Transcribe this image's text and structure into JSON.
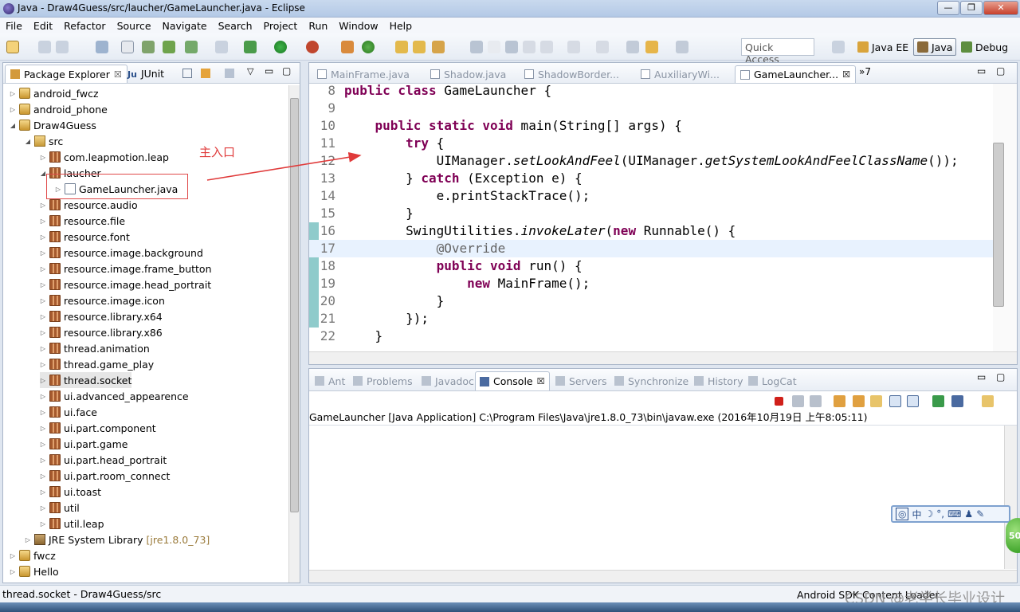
{
  "window": {
    "title": "Java - Draw4Guess/src/laucher/GameLauncher.java - Eclipse",
    "buttons": [
      "—",
      "❐",
      "✕"
    ]
  },
  "menu": [
    "File",
    "Edit",
    "Refactor",
    "Source",
    "Navigate",
    "Search",
    "Project",
    "Run",
    "Window",
    "Help"
  ],
  "toolbar": {
    "quick_access": "Quick Access",
    "perspectives": [
      "Java EE",
      "Java",
      "Debug"
    ],
    "active_perspective": "Java"
  },
  "explorer": {
    "tabs": [
      "Package Explorer",
      "JUnit"
    ],
    "tree": [
      {
        "label": "android_fwcz",
        "type": "proj",
        "depth": 0,
        "tw": "▷"
      },
      {
        "label": "android_phone",
        "type": "proj",
        "depth": 0,
        "tw": "▷"
      },
      {
        "label": "Draw4Guess",
        "type": "proj",
        "depth": 0,
        "tw": "◢"
      },
      {
        "label": "src",
        "type": "src",
        "depth": 1,
        "tw": "◢"
      },
      {
        "label": "com.leapmotion.leap",
        "type": "pkg",
        "depth": 2,
        "tw": "▷"
      },
      {
        "label": "laucher",
        "type": "pkg",
        "depth": 2,
        "tw": "◢"
      },
      {
        "label": "GameLauncher.java",
        "type": "java",
        "depth": 3,
        "tw": "▷"
      },
      {
        "label": "resource.audio",
        "type": "pkg",
        "depth": 2,
        "tw": "▷"
      },
      {
        "label": "resource.file",
        "type": "pkg",
        "depth": 2,
        "tw": "▷"
      },
      {
        "label": "resource.font",
        "type": "pkg",
        "depth": 2,
        "tw": "▷"
      },
      {
        "label": "resource.image.background",
        "type": "pkg",
        "depth": 2,
        "tw": "▷"
      },
      {
        "label": "resource.image.frame_button",
        "type": "pkg",
        "depth": 2,
        "tw": "▷"
      },
      {
        "label": "resource.image.head_portrait",
        "type": "pkg",
        "depth": 2,
        "tw": "▷"
      },
      {
        "label": "resource.image.icon",
        "type": "pkg",
        "depth": 2,
        "tw": "▷"
      },
      {
        "label": "resource.library.x64",
        "type": "pkg",
        "depth": 2,
        "tw": "▷"
      },
      {
        "label": "resource.library.x86",
        "type": "pkg",
        "depth": 2,
        "tw": "▷"
      },
      {
        "label": "thread.animation",
        "type": "pkg",
        "depth": 2,
        "tw": "▷"
      },
      {
        "label": "thread.game_play",
        "type": "pkg",
        "depth": 2,
        "tw": "▷"
      },
      {
        "label": "thread.socket",
        "type": "pkg",
        "depth": 2,
        "tw": "▷",
        "selected": true
      },
      {
        "label": "ui.advanced_appearence",
        "type": "pkg",
        "depth": 2,
        "tw": "▷"
      },
      {
        "label": "ui.face",
        "type": "pkg",
        "depth": 2,
        "tw": "▷"
      },
      {
        "label": "ui.part.component",
        "type": "pkg",
        "depth": 2,
        "tw": "▷"
      },
      {
        "label": "ui.part.game",
        "type": "pkg",
        "depth": 2,
        "tw": "▷"
      },
      {
        "label": "ui.part.head_portrait",
        "type": "pkg",
        "depth": 2,
        "tw": "▷"
      },
      {
        "label": "ui.part.room_connect",
        "type": "pkg",
        "depth": 2,
        "tw": "▷"
      },
      {
        "label": "ui.toast",
        "type": "pkg",
        "depth": 2,
        "tw": "▷"
      },
      {
        "label": "util",
        "type": "pkg",
        "depth": 2,
        "tw": "▷"
      },
      {
        "label": "util.leap",
        "type": "pkg",
        "depth": 2,
        "tw": "▷"
      },
      {
        "label": "JRE System Library",
        "type": "lib",
        "depth": 1,
        "tw": "▷",
        "suffix": "[jre1.8.0_73]"
      },
      {
        "label": "fwcz",
        "type": "proj",
        "depth": 0,
        "tw": "▷"
      },
      {
        "label": "Hello",
        "type": "proj",
        "depth": 0,
        "tw": "▷"
      }
    ]
  },
  "annotation": {
    "label": "主入口"
  },
  "editor": {
    "tabs": [
      "MainFrame.java",
      "Shadow.java",
      "ShadowBorder...",
      "AuxiliaryWi...",
      "GameLauncher..."
    ],
    "overflow": "»7",
    "lines": [
      {
        "n": "8",
        "html": "<span class='kw'>public class</span> GameLauncher {"
      },
      {
        "n": "9",
        "html": ""
      },
      {
        "n": "10",
        "html": "    <span class='kw'>public static void</span> main(String[] args) {"
      },
      {
        "n": "11",
        "html": "        <span class='kw'>try</span> {"
      },
      {
        "n": "12",
        "html": "            UIManager.<span class='it'>setLookAndFeel</span>(UIManager.<span class='it'>getSystemLookAndFeelClassName</span>());"
      },
      {
        "n": "13",
        "html": "        } <span class='kw'>catch</span> (Exception e) {"
      },
      {
        "n": "14",
        "html": "            e.printStackTrace();"
      },
      {
        "n": "15",
        "html": "        }"
      },
      {
        "n": "16",
        "html": "        SwingUtilities.<span class='it'>invokeLater</span>(<span class='kw'>new</span> Runnable() {"
      },
      {
        "n": "17",
        "html": "            <span class='an'>@Override</span>",
        "highlight": true
      },
      {
        "n": "18",
        "html": "            <span class='kw'>public void</span> run() {"
      },
      {
        "n": "19",
        "html": "                <span class='kw'>new</span> MainFrame();"
      },
      {
        "n": "20",
        "html": "            }"
      },
      {
        "n": "21",
        "html": "        });"
      },
      {
        "n": "22",
        "html": "    }"
      }
    ]
  },
  "console": {
    "tabs": [
      "Ant",
      "Problems",
      "Javadoc",
      "Console",
      "Servers",
      "Synchronize",
      "History",
      "LogCat"
    ],
    "active_tab": "Console",
    "launch_line": "GameLauncher [Java Application] C:\\Program Files\\Java\\jre1.8.0_73\\bin\\javaw.exe (2016年10月19日 上午8:05:11)"
  },
  "status": {
    "left": "thread.socket - Draw4Guess/src",
    "right": "Android SDK Content Loader"
  },
  "watermark": "CSDN @老学长毕业设计",
  "ime": {
    "glyphs": [
      "中",
      "☽",
      "°,",
      "⌨",
      "♟",
      "✎"
    ]
  },
  "badge": "50"
}
